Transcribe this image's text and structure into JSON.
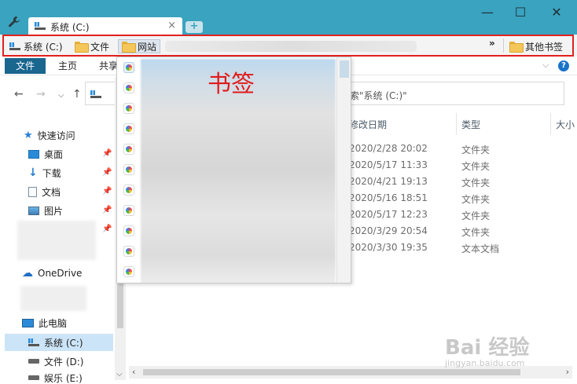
{
  "window": {
    "tab_title": "系统 (C:)",
    "tab_close": "×",
    "new_tab": "+",
    "minimize": "—",
    "maximize": "☐",
    "close": "✕"
  },
  "bookmarks_bar": {
    "items": [
      {
        "label": "系统 (C:)",
        "icon": "drive-icon"
      },
      {
        "label": "文件",
        "icon": "folder-icon"
      },
      {
        "label": "网站",
        "icon": "folder-icon"
      }
    ],
    "overflow": "»",
    "other_bookmarks": "其他书签"
  },
  "ribbon": {
    "tabs": [
      "文件",
      "主页",
      "共享"
    ],
    "help": "?",
    "collapse": "⌵"
  },
  "address": {
    "back": "←",
    "forward": "→",
    "history": "⌵",
    "up": "↑",
    "search_placeholder": "索\"系统 (C:)\""
  },
  "nav_pane": {
    "quick_access": "快速访问",
    "quick_items": [
      {
        "label": "桌面",
        "icon": "desktop-icon"
      },
      {
        "label": "下载",
        "icon": "download-icon"
      },
      {
        "label": "文档",
        "icon": "document-icon"
      },
      {
        "label": "图片",
        "icon": "picture-icon"
      }
    ],
    "onedrive": "OneDrive",
    "this_pc": "此电脑",
    "drives": [
      "系统 (C:)",
      "文件 (D:)",
      "娱乐 (E:)"
    ]
  },
  "file_list": {
    "columns": [
      "修改日期",
      "类型",
      "大小"
    ],
    "rows": [
      {
        "modified": "2020/2/28 20:02",
        "type": "文件夹"
      },
      {
        "modified": "2020/5/17 11:33",
        "type": "文件夹"
      },
      {
        "modified": "2020/4/21 19:13",
        "type": "文件夹"
      },
      {
        "modified": "2020/5/16 18:51",
        "type": "文件夹"
      },
      {
        "modified": "2020/5/17 12:23",
        "type": "文件夹"
      },
      {
        "modified": "2020/3/29 20:54",
        "type": "文件夹"
      },
      {
        "modified": "2020/3/30 19:35",
        "type": "文本文档"
      }
    ]
  },
  "dropdown": {
    "annotation": "书签",
    "item_count": 11
  },
  "watermark": {
    "brand": "Bai 经验",
    "url": "jingyan.baidu.com"
  },
  "colors": {
    "titlebar": "#3aa3bf",
    "ribbon_file_tab": "#19668f",
    "highlight_border": "#e22020",
    "annotation": "#e01b1b"
  }
}
